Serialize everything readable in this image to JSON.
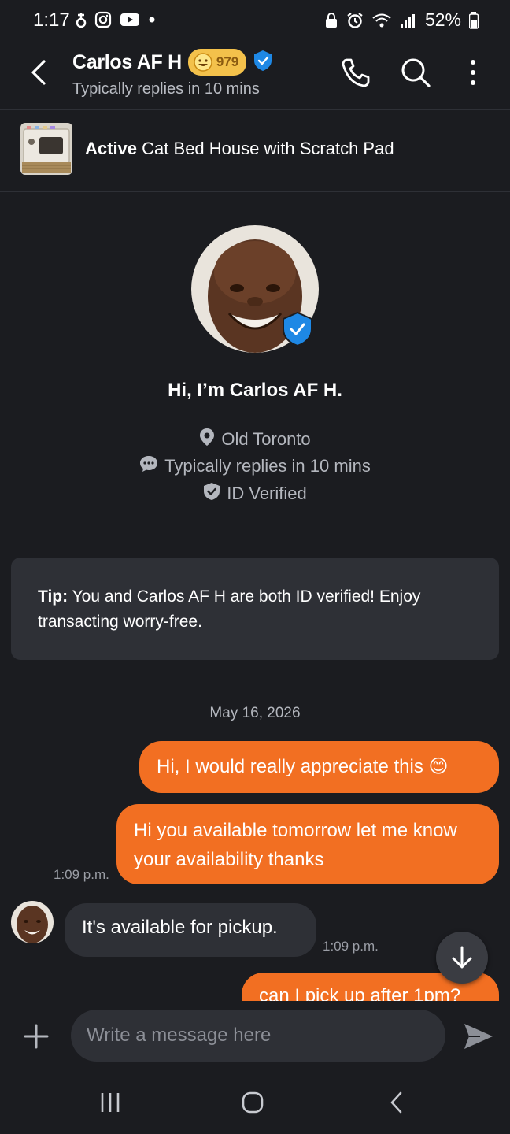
{
  "status_bar": {
    "time": "1:17",
    "battery": "52%"
  },
  "header": {
    "name": "Carlos AF H",
    "score": "979",
    "subtitle": "Typically replies in 10 mins"
  },
  "listing": {
    "status": "Active",
    "title": "Cat Bed House with Scratch Pad"
  },
  "profile": {
    "greeting": "Hi, I’m Carlos AF H.",
    "location": "Old Toronto",
    "replies": "Typically replies in 10 mins",
    "verified": "ID Verified"
  },
  "tip": {
    "label": "Tip:",
    "text": "You and Carlos AF H are both ID verified! Enjoy transacting worry-free."
  },
  "messages": {
    "date": "May 16, 2026",
    "m1": "Hi, I would really appreciate this 😊",
    "m2": "Hi you available tomorrow let me know your availability thanks",
    "m2_time": "1:09 p.m.",
    "m3": "It's available for pickup.",
    "m3_time": "1:09 p.m.",
    "m4": "can I pick up after 1pm?"
  },
  "composer": {
    "placeholder": "Write a message here"
  },
  "colors": {
    "accent": "#f26f22",
    "background": "#1b1c20",
    "surface": "#2e3036",
    "verified_blue": "#1e88e5",
    "score_badge": "#f3c14b"
  }
}
